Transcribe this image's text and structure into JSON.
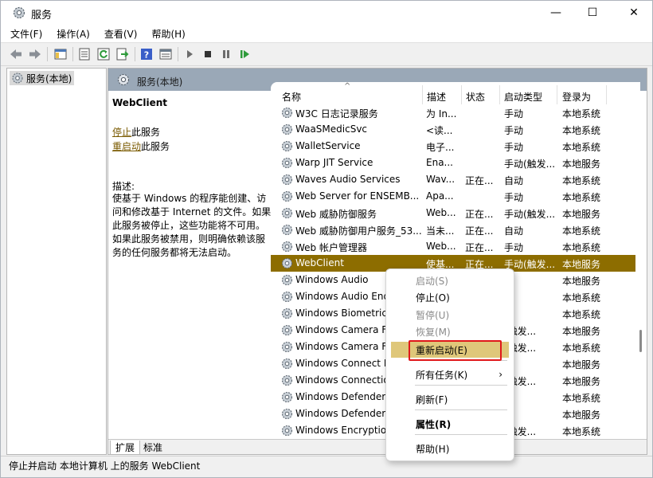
{
  "window": {
    "title": "服务",
    "buttons": {
      "minimize": "—",
      "maximize": "☐",
      "close": "✕"
    }
  },
  "menu": [
    "文件(F)",
    "操作(A)",
    "查看(V)",
    "帮助(H)"
  ],
  "tree": {
    "node": "服务(本地)"
  },
  "panel_header": "服务(本地)",
  "description": {
    "service_name": "WebClient",
    "stop_link": "停止",
    "stop_suffix": "此服务",
    "restart_link": "重启动",
    "restart_suffix": "此服务",
    "label": "描述:",
    "text": "使基于 Windows 的程序能创建、访问和修改基于 Internet 的文件。如果此服务被停止，这些功能将不可用。如果此服务被禁用，则明确依赖该服务的任何服务都将无法启动。"
  },
  "columns": [
    "名称",
    "描述",
    "状态",
    "启动类型",
    "登录为"
  ],
  "sort_indicator": "^",
  "rows": [
    [
      "W3C 日志记录服务",
      "为 In...",
      "",
      "手动",
      "本地系统"
    ],
    [
      "WaaSMedicSvc",
      "<读...",
      "",
      "手动",
      "本地系统"
    ],
    [
      "WalletService",
      "电子...",
      "",
      "手动",
      "本地系统"
    ],
    [
      "Warp JIT Service",
      "Ena...",
      "",
      "手动(触发...",
      "本地服务"
    ],
    [
      "Waves Audio Services",
      "Wav...",
      "正在...",
      "自动",
      "本地系统"
    ],
    [
      "Web Server for ENSEMB...",
      "Apa...",
      "",
      "手动",
      "本地系统"
    ],
    [
      "Web 威胁防御服务",
      "Web...",
      "正在...",
      "手动(触发...",
      "本地服务"
    ],
    [
      "Web 威胁防御用户服务_53...",
      "当未...",
      "正在...",
      "自动",
      "本地系统"
    ],
    [
      "Web 帐户管理器",
      "Web...",
      "正在...",
      "手动",
      "本地系统"
    ],
    [
      "WebClient",
      "使基...",
      "正在...",
      "手动(触发...",
      "本地服务"
    ],
    [
      "Windows Audio",
      "",
      "",
      "",
      "本地服务"
    ],
    [
      "Windows Audio Endpoint Builder",
      "",
      "",
      "",
      "本地系统"
    ],
    [
      "Windows Biometric Service",
      "",
      "",
      "",
      "本地系统"
    ],
    [
      "Windows Camera Frame Server",
      "",
      "",
      "(触发...",
      "本地服务"
    ],
    [
      "Windows Camera Frame Server Monitor",
      "",
      "",
      "(触发...",
      "本地系统"
    ],
    [
      "Windows Connect Now",
      "",
      "",
      "",
      "本地服务"
    ],
    [
      "Windows Connection Manager",
      "",
      "",
      "(触发...",
      "本地服务"
    ],
    [
      "Windows Defender Advanced Threat",
      "",
      "",
      "",
      "本地系统"
    ],
    [
      "Windows Defender Firewall",
      "",
      "",
      "",
      "本地服务"
    ],
    [
      "Windows Encryption Provider",
      "",
      "",
      "(触发...",
      "本地系统"
    ]
  ],
  "selected_row_index": 9,
  "tabs": [
    "扩展",
    "标准"
  ],
  "status_text": "停止并启动 本地计算机 上的服务 WebClient",
  "context_menu": [
    {
      "label": "启动(S)",
      "disabled": true
    },
    {
      "label": "停止(O)",
      "disabled": false
    },
    {
      "label": "暂停(U)",
      "disabled": true
    },
    {
      "label": "恢复(M)",
      "disabled": true
    },
    {
      "label": "重新启动(E)",
      "disabled": false,
      "highlighted": true
    },
    {
      "label": "所有任务(K)",
      "disabled": false,
      "submenu": "›"
    },
    {
      "label": "刷新(F)",
      "disabled": false
    },
    {
      "label": "属性(R)",
      "disabled": false,
      "bold": true
    },
    {
      "label": "帮助(H)",
      "disabled": false
    }
  ],
  "colors": {
    "selection": "#8d6d00",
    "highlight": "#dfc77a",
    "annotation": "#e0181b",
    "header": "#9aa8b7"
  }
}
